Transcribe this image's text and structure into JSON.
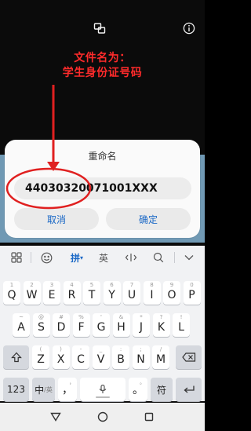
{
  "annotation": {
    "line1": "文件名为：",
    "line2": "学生身份证号码"
  },
  "dialog": {
    "title": "重命名",
    "filename_value": "44030320071001XXX",
    "cancel_label": "取消",
    "confirm_label": "确定"
  },
  "keyboard": {
    "toolbar": {
      "pinyin_label": "拼",
      "english_label": "英"
    },
    "row1": [
      {
        "key": "Q",
        "hint": "1"
      },
      {
        "key": "W",
        "hint": "2"
      },
      {
        "key": "E",
        "hint": "3"
      },
      {
        "key": "R",
        "hint": "4"
      },
      {
        "key": "T",
        "hint": "5"
      },
      {
        "key": "Y",
        "hint": "6"
      },
      {
        "key": "U",
        "hint": "7"
      },
      {
        "key": "I",
        "hint": "8"
      },
      {
        "key": "O",
        "hint": "9"
      },
      {
        "key": "P",
        "hint": "0"
      }
    ],
    "row2": [
      {
        "key": "A",
        "hint": "~"
      },
      {
        "key": "S",
        "hint": "@"
      },
      {
        "key": "D",
        "hint": "#"
      },
      {
        "key": "F",
        "hint": "%"
      },
      {
        "key": "G",
        "hint": "'"
      },
      {
        "key": "H",
        "hint": "&"
      },
      {
        "key": "J",
        "hint": "*"
      },
      {
        "key": "K",
        "hint": "?"
      },
      {
        "key": "L",
        "hint": "!"
      }
    ],
    "row3": [
      {
        "key": "Z",
        "hint": "("
      },
      {
        "key": "X",
        "hint": ")"
      },
      {
        "key": "C",
        "hint": "-"
      },
      {
        "key": "V",
        "hint": "_"
      },
      {
        "key": "B",
        "hint": ":"
      },
      {
        "key": "N",
        "hint": ";"
      },
      {
        "key": "M",
        "hint": "/"
      }
    ],
    "bottom": {
      "num_label": "123",
      "lang_label": "中",
      "lang_sub": "/英",
      "comma_label": "，",
      "comma_hint": "，",
      "period_label": "。",
      "period_hint": "。",
      "symbol_label": "符"
    }
  },
  "colors": {
    "accent": "#1a68c6",
    "annotation": "#ff2b2b",
    "background": "#0b0b0b",
    "keyboard_bg": "#f1f2f4"
  }
}
